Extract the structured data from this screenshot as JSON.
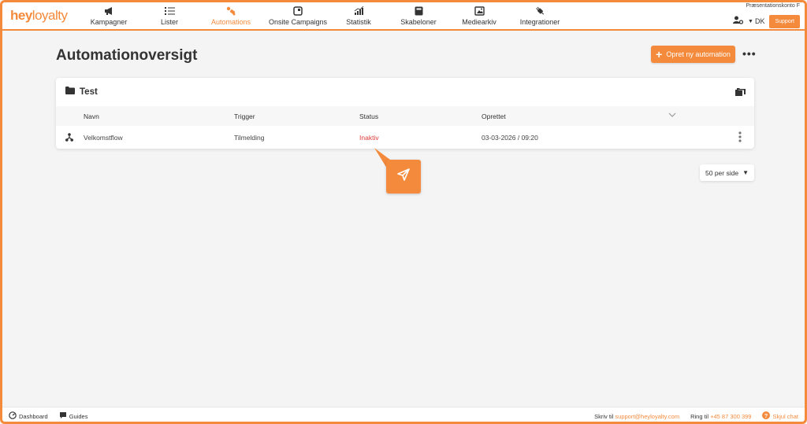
{
  "header": {
    "logo_bold": "hey",
    "logo_light": "loyalty",
    "account_name": "Præsentationskonto F",
    "language": "DK",
    "support_label": "Support",
    "nav": [
      {
        "label": "Kampagner",
        "icon": "megaphone-icon",
        "active": false
      },
      {
        "label": "Lister",
        "icon": "list-icon",
        "active": false
      },
      {
        "label": "Automations",
        "icon": "automation-icon",
        "active": true
      },
      {
        "label": "Onsite Campaigns",
        "icon": "onsite-icon",
        "active": false
      },
      {
        "label": "Statistik",
        "icon": "chart-icon",
        "active": false
      },
      {
        "label": "Skabeloner",
        "icon": "template-icon",
        "active": false
      },
      {
        "label": "Mediearkiv",
        "icon": "image-icon",
        "active": false
      },
      {
        "label": "Integrationer",
        "icon": "plug-icon",
        "active": false
      }
    ]
  },
  "page": {
    "title": "Automationoversigt",
    "create_label": "Opret ny automation",
    "more_label": "•••"
  },
  "folder": {
    "name": "Test",
    "columns": {
      "name": "Navn",
      "trigger": "Trigger",
      "status": "Status",
      "created": "Oprettet"
    },
    "rows": [
      {
        "name": "Velkomstflow",
        "trigger": "Tilmelding",
        "status": "Inaktiv",
        "created": "03-03-2026 / 09:20"
      }
    ]
  },
  "pagination": {
    "per_page": "50 per side"
  },
  "footer": {
    "dashboard": "Dashboard",
    "guides": "Guides",
    "write_prefix": "Skriv til",
    "email": "support@heyloyalty.com",
    "call_prefix": "Ring til",
    "phone": "+45 87 300 399",
    "hide_chat": "Skjul chat"
  },
  "colors": {
    "accent": "#f48a3c",
    "inactive": "#e03b3b"
  }
}
